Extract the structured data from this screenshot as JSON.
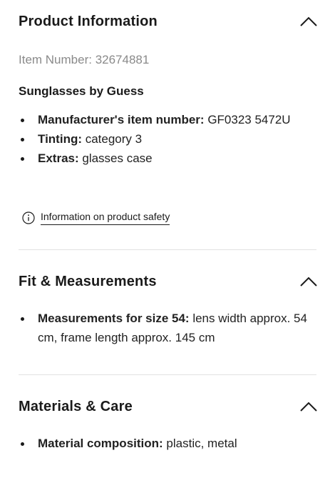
{
  "product_info": {
    "title": "Product Information",
    "item_number": "Item Number: 32674881",
    "brand_line": "Sunglasses by Guess",
    "attributes": [
      {
        "key": "Manufacturer's item number:",
        "value": " GF0323 5472U"
      },
      {
        "key": "Tinting:",
        "value": " category 3"
      },
      {
        "key": "Extras:",
        "value": " glasses case"
      }
    ],
    "safety_link": "Information on product safety"
  },
  "fit": {
    "title": "Fit & Measurements",
    "attributes": [
      {
        "key": "Measurements for size 54:",
        "value": " lens width approx. 54 cm, frame length approx. 145 cm"
      }
    ]
  },
  "materials": {
    "title": "Materials & Care",
    "attributes": [
      {
        "key": "Material composition:",
        "value": " plastic, metal"
      }
    ]
  },
  "icons": {
    "collapse": "chevron-up-icon",
    "info": "info-circle-icon"
  }
}
